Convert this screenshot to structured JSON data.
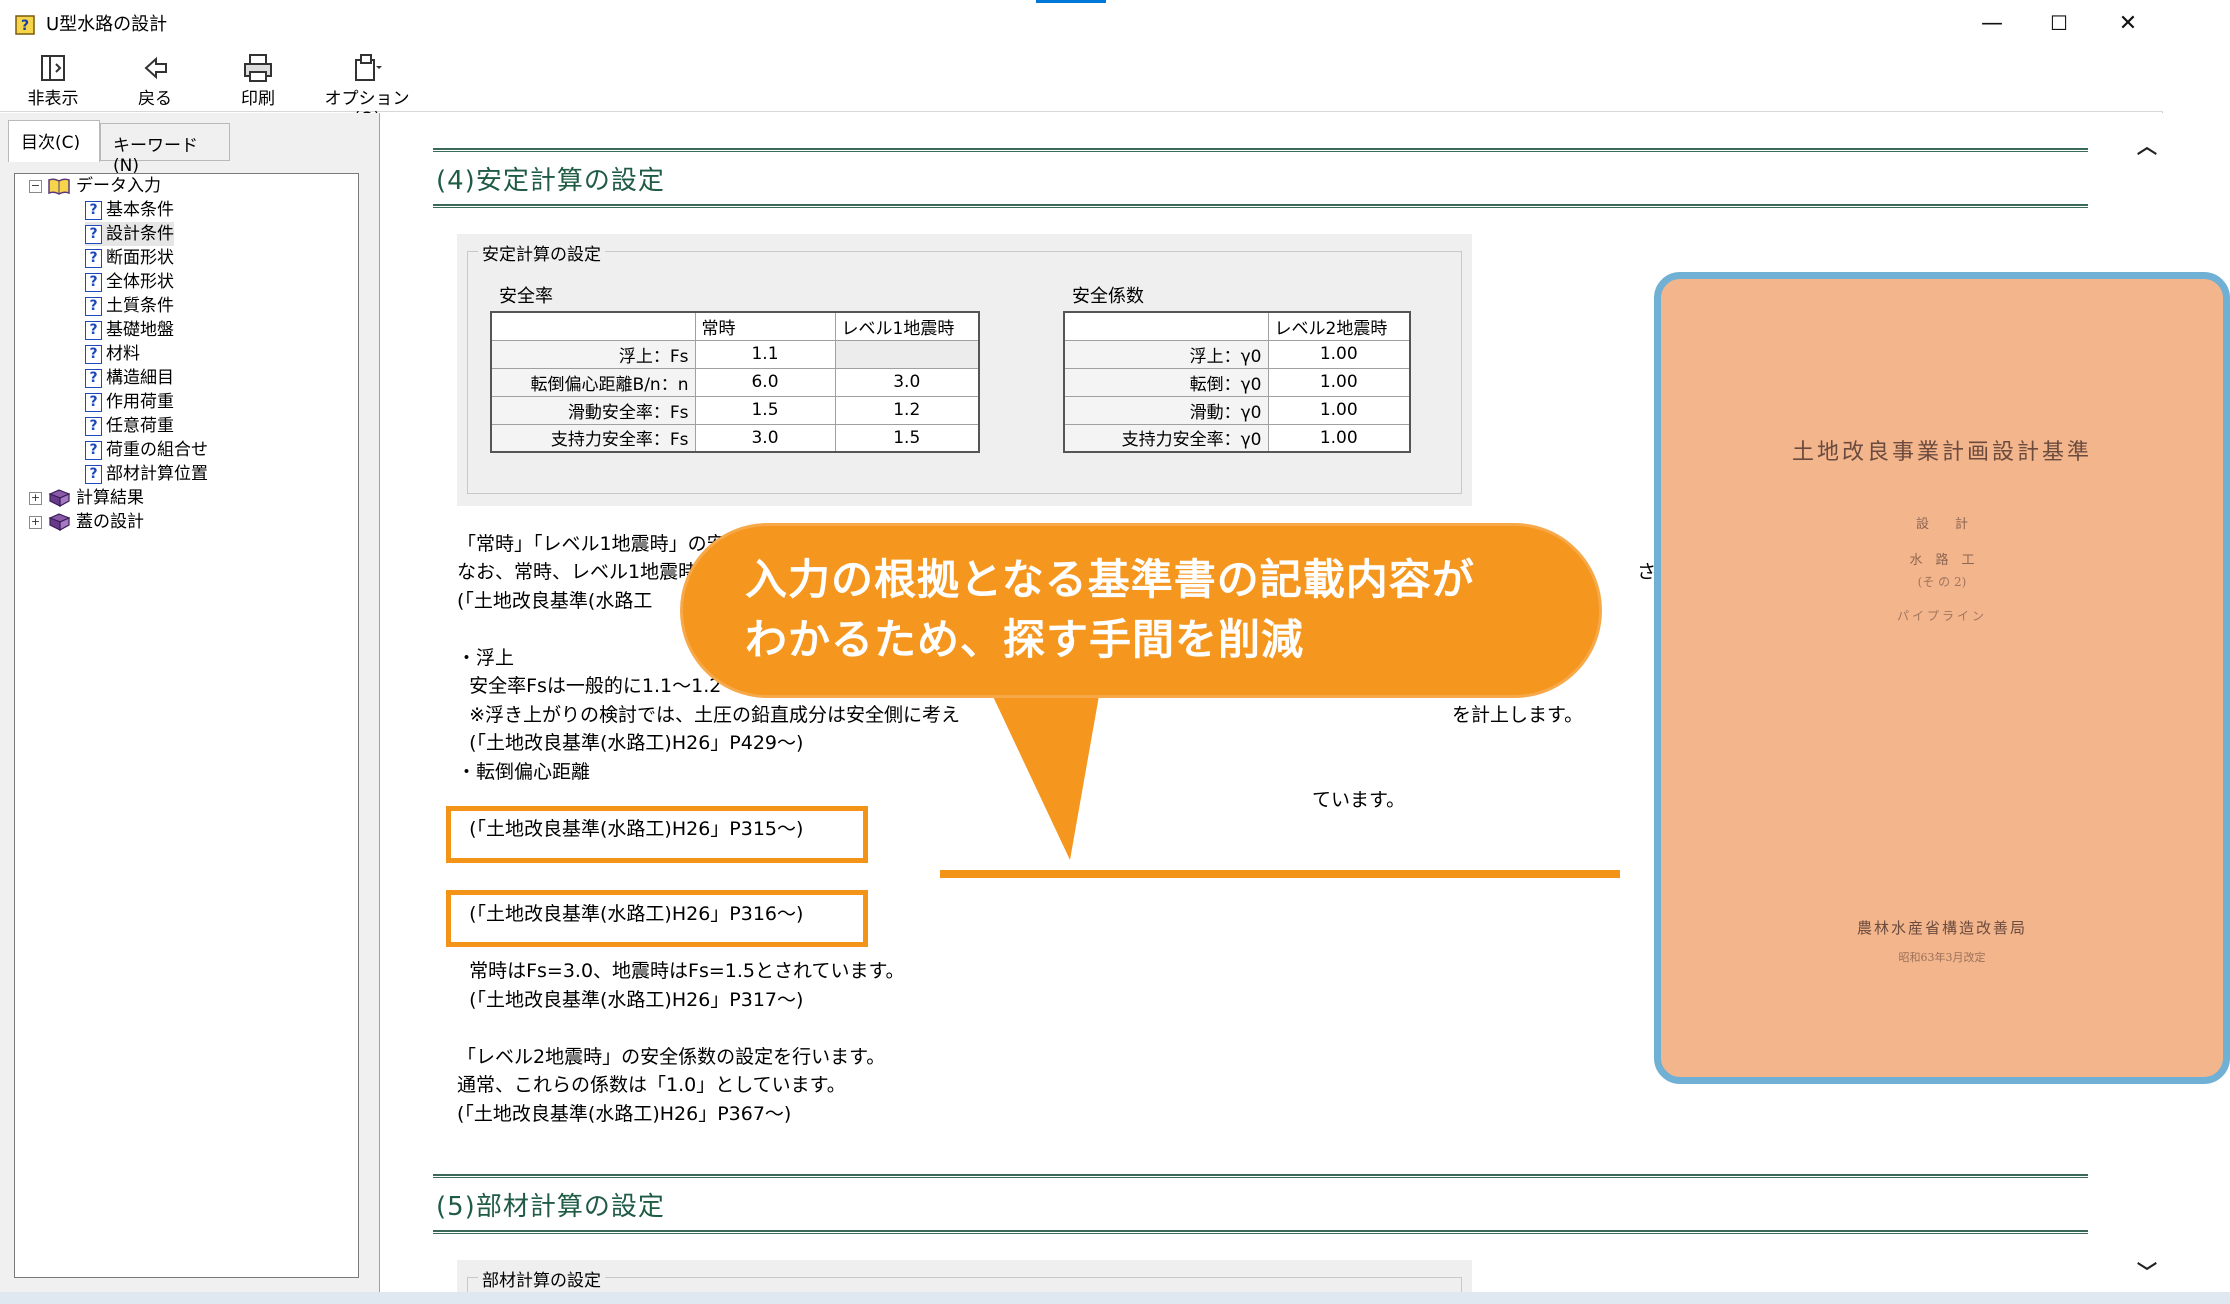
{
  "window": {
    "title": "U型水路の設計",
    "minimize": "—",
    "maximize": "☐",
    "close": "✕"
  },
  "toolbar": {
    "hide_label": "非表示",
    "back_label": "戻る",
    "print_label": "印刷",
    "options_label": "オプション(O)"
  },
  "tabs": {
    "contents": "目次(C)",
    "keyword": "キーワード(N)"
  },
  "tree": {
    "root": "データ入力",
    "items": [
      "基本条件",
      "設計条件",
      "断面形状",
      "全体形状",
      "土質条件",
      "基礎地盤",
      "材料",
      "構造細目",
      "作用荷重",
      "任意荷重",
      "荷重の組合せ",
      "部材計算位置"
    ],
    "results": "計算結果",
    "lid": "蓋の設計"
  },
  "section4": {
    "title": "(4)安定計算の設定",
    "group_title": "安定計算の設定",
    "safety_rate": {
      "title": "安全率",
      "headers": [
        "常時",
        "レベル1地震時"
      ],
      "rows": [
        {
          "label": "浮上：Fs",
          "normal": "1.1",
          "level1": ""
        },
        {
          "label": "転倒偏心距離B/n：n",
          "normal": "6.0",
          "level1": "3.0"
        },
        {
          "label": "滑動安全率：Fs",
          "normal": "1.5",
          "level1": "1.2"
        },
        {
          "label": "支持力安全率：Fs",
          "normal": "3.0",
          "level1": "1.5"
        }
      ]
    },
    "safety_coef": {
      "title": "安全係数",
      "header": "レベル2地震時",
      "rows": [
        {
          "label": "浮上：γ0",
          "value": "1.00"
        },
        {
          "label": "転倒：γ0",
          "value": "1.00"
        },
        {
          "label": "滑動：γ0",
          "value": "1.00"
        },
        {
          "label": "支持力安全率：γ0",
          "value": "1.00"
        }
      ]
    },
    "text": {
      "l1": "「常時」「レベル1地震時」の安",
      "l2": "なお、常時、レベル1地震時",
      "l2b": "されて",
      "l3": "(「土地改良基準(水路工",
      "l5": "・浮上",
      "l6": "  安全率Fsは一般的に1.1〜1.2",
      "l7": "  ※浮き上がりの検討では、土圧の鉛直成分は安全側に考え",
      "l7b": "を計上します。",
      "l8": "  (「土地改良基準(水路工)H26」P429〜)",
      "l9": "・転倒偏心距離",
      "l10": "ています。",
      "l11": "  (「土地改良基準(水路工)H26」P315〜)",
      "l12": "  (「土地改良基準(水路工)H26」P316〜)",
      "l13": "  常時はFs=3.0、地震時はFs=1.5とされています。",
      "l14": "  (「土地改良基準(水路工)H26」P317〜)",
      "l16": "「レベル2地震時」の安全係数の設定を行います。",
      "l17": "通常、これらの係数は「1.0」としています。",
      "l18": "(「土地改良基準(水路工)H26」P367〜)"
    }
  },
  "section5": {
    "title": "(5)部材計算の設定",
    "group_title": "部材計算の設定"
  },
  "callout": {
    "text": "入力の根拠となる基準書の記載内容が\nわかるため、探す手間を削減"
  },
  "book": {
    "title": "土地改良事業計画設計基準",
    "line1": "設　　計",
    "line2": "水　路　工",
    "line3": "(そ の 2)",
    "line4": "パイプライン",
    "publisher": "農林水産省構造改善局",
    "date": "昭和63年3月改定"
  },
  "colors": {
    "accent_orange": "#f39419",
    "heading_green": "#1f5b45",
    "frame_blue": "#6fb0d4"
  }
}
